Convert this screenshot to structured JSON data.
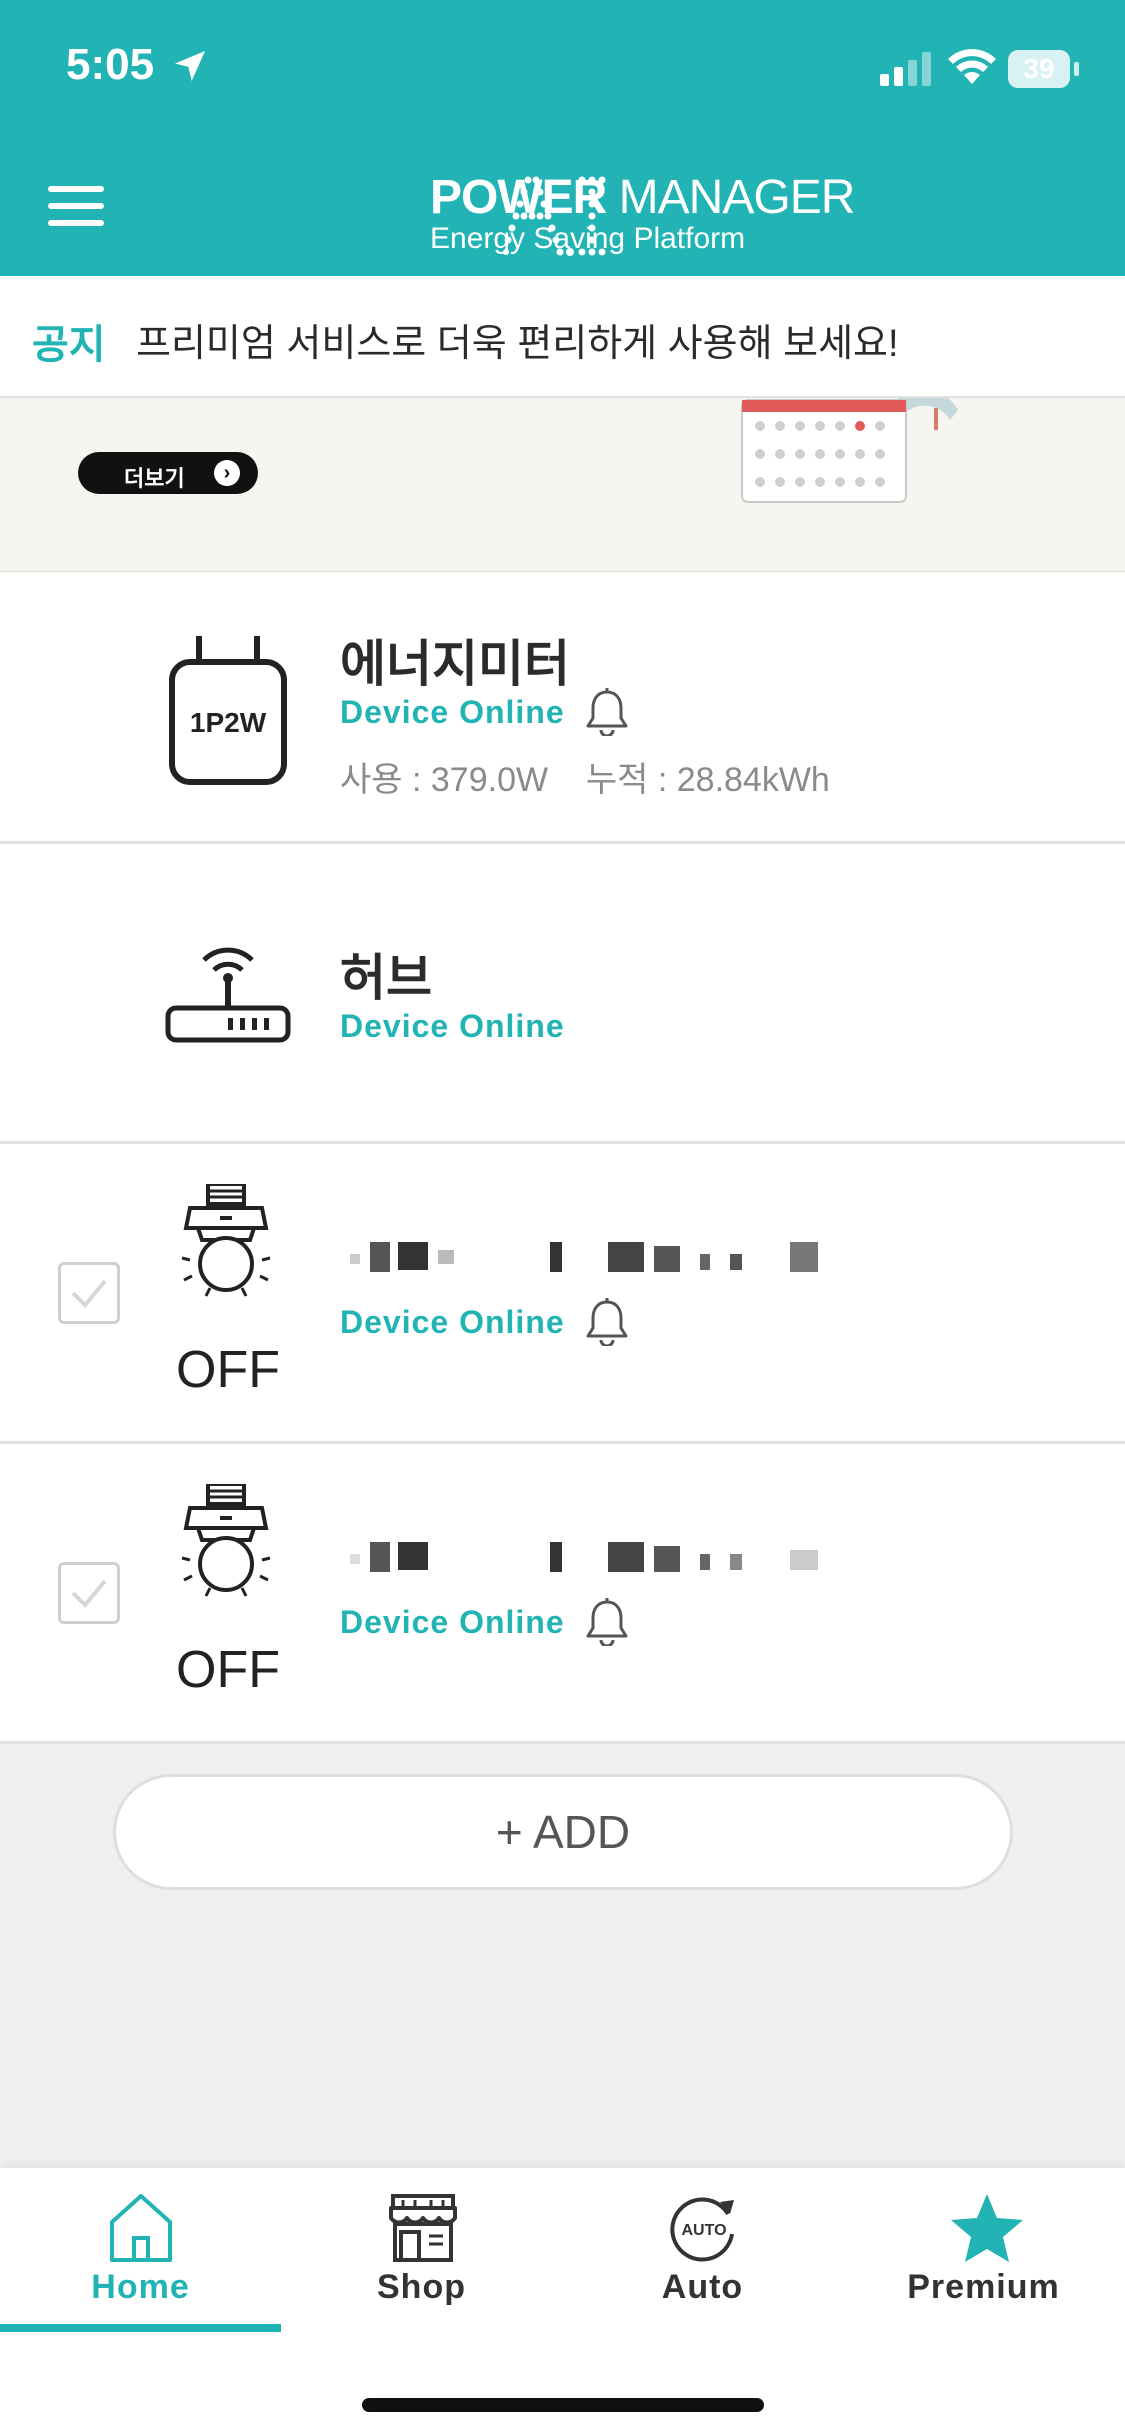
{
  "status_bar": {
    "time": "5:05",
    "battery": "39"
  },
  "header": {
    "logo_mark": "AI",
    "logo_title_bold": "POWER",
    "logo_title_rest": " MANAGER",
    "logo_subtitle": "Energy Saving Platform"
  },
  "notice": {
    "tag": "공지",
    "text": "프리미엄 서비스로 더욱 편리하게 사용해 보세요!"
  },
  "banner": {
    "more_label": "더보기",
    "more_arrow": "›"
  },
  "devices": [
    {
      "icon": "energy-meter-icon",
      "icon_text": "1P2W",
      "name": "에너지미터",
      "status": "Device Online",
      "usage": "사용 : 379.0W    누적 : 28.84kWh"
    },
    {
      "icon": "router-icon",
      "name": "허브",
      "status": "Device Online"
    },
    {
      "icon": "bulb-socket-icon",
      "state": "OFF",
      "status": "Device Online"
    },
    {
      "icon": "bulb-socket-icon",
      "state": "OFF",
      "status": "Device Online"
    }
  ],
  "add_button": {
    "label": "+ ADD"
  },
  "tabs": [
    {
      "label": "Home",
      "icon": "home-icon"
    },
    {
      "label": "Shop",
      "icon": "shop-icon"
    },
    {
      "label": "Auto",
      "icon": "auto-icon",
      "icon_text": "AUTO"
    },
    {
      "label": "Premium",
      "icon": "star-icon"
    }
  ],
  "colors": {
    "accent": "#22b3b4",
    "text": "#2b2b2b",
    "muted": "#8a8a8a"
  }
}
